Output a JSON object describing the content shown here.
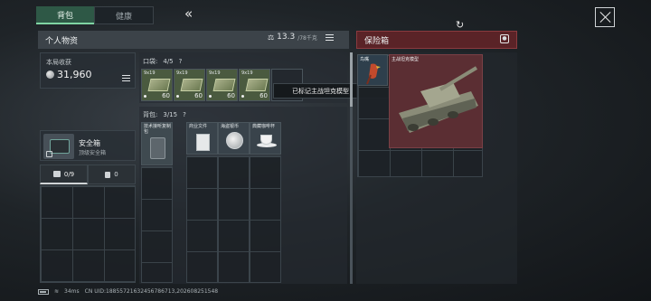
{
  "tabs": [
    {
      "label": "背包",
      "active": true
    },
    {
      "label": "健康",
      "active": false
    }
  ],
  "collapse_glyph": "«",
  "left_panel": {
    "title": "个人物资",
    "weight": "13.3",
    "weight_max": "/78千克"
  },
  "income": {
    "label": "本局收获",
    "value": "31,960"
  },
  "safe_box_item": {
    "name": "安全箱",
    "grade": "顶级安全箱"
  },
  "container_tabs": [
    {
      "label": "0/9",
      "icon": "briefcase-icon"
    },
    {
      "label": "0",
      "icon": "trash-icon"
    }
  ],
  "pocket": {
    "label": "口袋:",
    "count": "4/5",
    "help": "?",
    "items": [
      {
        "name": "9x19",
        "qty": "60"
      },
      {
        "name": "9x19",
        "qty": "60"
      },
      {
        "name": "9x19",
        "qty": "60"
      },
      {
        "name": "9x19",
        "qty": "60"
      }
    ]
  },
  "tooltip": "已标记主战坦克模型",
  "backpack": {
    "label": "背包:",
    "count": "3/15",
    "help": "?",
    "items": [
      {
        "name": "技术接听复制包"
      },
      {
        "name": "商业文件"
      },
      {
        "name": "海盗银币"
      },
      {
        "name": "典藏咖啡杯"
      }
    ]
  },
  "right_panel": {
    "title": "保险箱"
  },
  "safe_box_contents": [
    {
      "name": "鸟嘴"
    },
    {
      "name": "主战坦克模型"
    }
  ],
  "status_bar": {
    "ping": "34ms",
    "uid": "CN UID:18855721632456786713,202608251548"
  },
  "colors": {
    "accent_green": "#2e5846",
    "safe_red": "#5a2327",
    "tank_bg": "#5b2e33"
  }
}
